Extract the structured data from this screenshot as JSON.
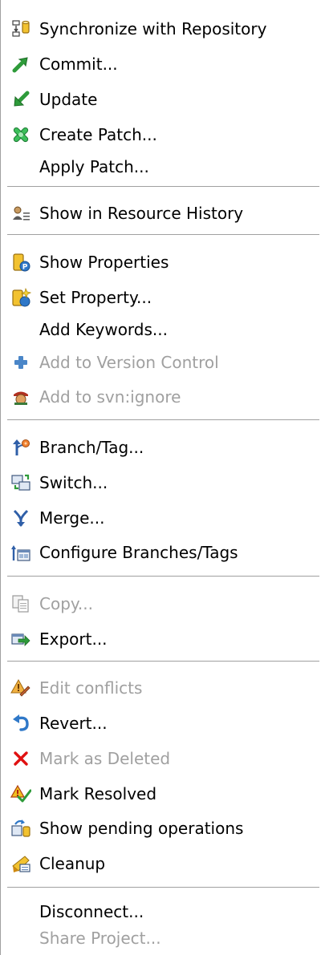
{
  "menu": {
    "items": [
      {
        "label": "Synchronize with Repository",
        "icon": "synchronize-icon",
        "enabled": true
      },
      {
        "label": "Commit...",
        "icon": "commit-arrow-icon",
        "enabled": true
      },
      {
        "label": "Update",
        "icon": "update-arrow-icon",
        "enabled": true
      },
      {
        "label": "Create Patch...",
        "icon": "create-patch-icon",
        "enabled": true
      },
      {
        "label": "Apply Patch...",
        "icon": "",
        "enabled": true
      },
      {
        "label": "Show in Resource History",
        "icon": "resource-history-icon",
        "enabled": true
      },
      {
        "label": "Show Properties",
        "icon": "show-properties-icon",
        "enabled": true
      },
      {
        "label": "Set Property...",
        "icon": "set-property-icon",
        "enabled": true
      },
      {
        "label": "Add Keywords...",
        "icon": "",
        "enabled": true
      },
      {
        "label": "Add to Version Control",
        "icon": "add-plus-icon",
        "enabled": false
      },
      {
        "label": "Add to svn:ignore",
        "icon": "svn-ignore-icon",
        "enabled": false
      },
      {
        "label": "Branch/Tag...",
        "icon": "branch-tag-icon",
        "enabled": true
      },
      {
        "label": "Switch...",
        "icon": "switch-icon",
        "enabled": true
      },
      {
        "label": "Merge...",
        "icon": "merge-icon",
        "enabled": true
      },
      {
        "label": "Configure Branches/Tags",
        "icon": "configure-branches-icon",
        "enabled": true
      },
      {
        "label": "Copy...",
        "icon": "copy-icon",
        "enabled": false
      },
      {
        "label": "Export...",
        "icon": "export-icon",
        "enabled": true
      },
      {
        "label": "Edit conflicts",
        "icon": "edit-conflicts-icon",
        "enabled": false
      },
      {
        "label": "Revert...",
        "icon": "revert-icon",
        "enabled": true
      },
      {
        "label": "Mark as Deleted",
        "icon": "delete-x-icon",
        "enabled": false
      },
      {
        "label": "Mark Resolved",
        "icon": "mark-resolved-icon",
        "enabled": true
      },
      {
        "label": "Show pending operations",
        "icon": "pending-operations-icon",
        "enabled": true
      },
      {
        "label": "Cleanup",
        "icon": "cleanup-icon",
        "enabled": true
      },
      {
        "label": "Disconnect...",
        "icon": "",
        "enabled": true
      },
      {
        "label": "Share Project...",
        "icon": "",
        "enabled": false
      }
    ]
  },
  "colors": {
    "text": "#000000",
    "disabled_text": "#a0a0a0",
    "separator": "#a0a0a0",
    "background": "#ffffff"
  }
}
